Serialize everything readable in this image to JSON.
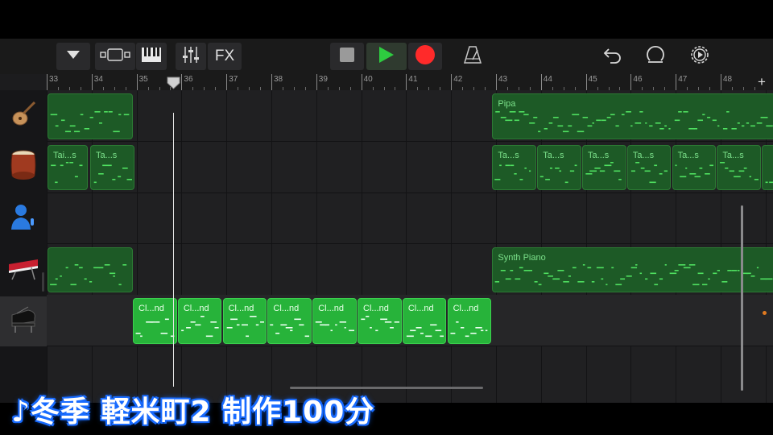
{
  "toolbar": {
    "fx_label": "FX",
    "buttons": [
      {
        "name": "browser-dropdown",
        "icon": "triangle-down-icon"
      },
      {
        "name": "tracks-view",
        "icon": "tracks-view-icon"
      },
      {
        "name": "keyboard",
        "icon": "piano-keys-icon"
      },
      {
        "name": "mixer",
        "icon": "mixer-sliders-icon"
      },
      {
        "name": "fx",
        "icon": "fx-icon"
      },
      {
        "name": "stop",
        "icon": "stop-square-icon"
      },
      {
        "name": "play",
        "icon": "play-triangle-icon"
      },
      {
        "name": "record",
        "icon": "record-circle-icon"
      },
      {
        "name": "metronome",
        "icon": "metronome-icon"
      },
      {
        "name": "undo",
        "icon": "undo-arrow-icon"
      },
      {
        "name": "loop-browser",
        "icon": "loop-icon"
      },
      {
        "name": "settings",
        "icon": "gear-icon"
      }
    ],
    "colors": {
      "play": "#2ecc40",
      "record": "#ff2a2a",
      "stop": "#9a9a9a"
    }
  },
  "ruler": {
    "bars": [
      "33",
      "34",
      "35",
      "36",
      "37",
      "38",
      "39",
      "40",
      "41",
      "42",
      "43",
      "44",
      "45",
      "46",
      "47",
      "48"
    ],
    "add_label": "+"
  },
  "tracks": [
    {
      "instrument": "pipa",
      "icon": "pipa-icon",
      "regions": [
        {
          "label": "",
          "style": "dark"
        },
        {
          "label": "Pipa",
          "style": "dark"
        }
      ]
    },
    {
      "instrument": "taiko",
      "icon": "taiko-drum-icon",
      "regions": [
        {
          "label": "Tai...s",
          "style": "dark"
        },
        {
          "label": "Ta...s",
          "style": "dark"
        },
        {
          "label": "Ta...s",
          "style": "dark"
        },
        {
          "label": "Ta...s",
          "style": "dark"
        },
        {
          "label": "Ta...s",
          "style": "dark"
        },
        {
          "label": "Ta...s",
          "style": "dark"
        },
        {
          "label": "Ta...s",
          "style": "dark"
        },
        {
          "label": "Ta...s",
          "style": "dark"
        },
        {
          "label": "",
          "style": "dark"
        }
      ]
    },
    {
      "instrument": "vocal",
      "icon": "singer-mic-icon",
      "regions": []
    },
    {
      "instrument": "synth-piano",
      "icon": "keyboard-synth-icon",
      "regions": [
        {
          "label": "",
          "style": "dark"
        },
        {
          "label": "Synth Piano",
          "style": "dark"
        }
      ]
    },
    {
      "instrument": "grand-piano",
      "icon": "grand-piano-icon",
      "selected": true,
      "regions": [
        {
          "label": "Cl...nd",
          "style": "bright"
        },
        {
          "label": "Cl...nd",
          "style": "bright"
        },
        {
          "label": "Cl...nd",
          "style": "bright"
        },
        {
          "label": "Cl...nd",
          "style": "bright"
        },
        {
          "label": "Cl...nd",
          "style": "bright"
        },
        {
          "label": "Cl...nd",
          "style": "bright"
        },
        {
          "label": "Cl...nd",
          "style": "bright"
        },
        {
          "label": "Cl...nd",
          "style": "bright"
        }
      ]
    }
  ],
  "add_track_label": "+",
  "caption": "♪冬季 軽米町2 制作100分",
  "colors": {
    "region_dark": "#1d5a26",
    "region_bright": "#27b33a",
    "caption_glow": "#1a6cff"
  }
}
